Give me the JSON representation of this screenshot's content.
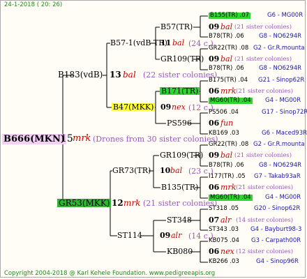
{
  "date": "24-1-2018 ( 20: 26)",
  "root": {
    "id": "B666(MKN)",
    "num": "15",
    "bal": "mrk",
    "note": "(Drones from 30 sister colonies)"
  },
  "gen2": [
    {
      "id": "B183(vdB)",
      "num": "13",
      "bal": "bal",
      "note": "(22 sister colonies)"
    },
    {
      "id": "GR53(MKK)",
      "num": "12",
      "bal": "mrk",
      "note": "(21 sister colonies)"
    }
  ],
  "gen3": [
    {
      "id": "B57-1(vdB-TR)",
      "num": "11",
      "bal": "bal",
      "note": "(24 c.)"
    },
    {
      "id": "B47(MKK)",
      "num": "09",
      "bal": "nex",
      "note": "(12 c.)"
    },
    {
      "id": "GR73(TR)",
      "num": "10",
      "bal": "bal",
      "note": "(23 c.)"
    },
    {
      "id": "ST114",
      "num": "09",
      "bal": "alr",
      "note": "(14 c.)"
    }
  ],
  "gen4": [
    "B57(TR)",
    "GR109(TR)",
    "B171(TR)",
    "PS596",
    "GR109(TR)",
    "B135(TR)",
    "ST348",
    "KB080"
  ],
  "gen5": [
    {
      "top": "B155(TR) .07",
      "top_r": "G6 - MG00R",
      "num": "09",
      "bal": "bal",
      "note": "(21 sister colonies)",
      "bot": "B78(TR) .06",
      "bot_r": "G8 - NO6294R"
    },
    {
      "top": "GR22(TR) .08",
      "top_r": "G2 - Gr.R.mounta",
      "num": "09",
      "bal": "bal",
      "note": "(21 sister colonies)",
      "bot": "B78(TR) .06",
      "bot_r": "G8 - NO6294R"
    },
    {
      "top": "B175(TR) .04",
      "top_r": "G21 - Sinop62R",
      "num": "06",
      "bal": "mrk",
      "note": "(21 sister colonies)",
      "bot": "MG60(TR) .04",
      "bot_r": "G4 - MG00R"
    },
    {
      "top": "PS506 .04",
      "top_r": "G17 - Sinop72R",
      "num": "06",
      "bal": "fun",
      "note": "",
      "bot": "KB169 .03",
      "bot_r": "G6 - Maced93R"
    },
    {
      "top": "GR22(TR) .08",
      "top_r": "G2 - Gr.R.mounta",
      "num": "09",
      "bal": "bal",
      "note": "(21 sister colonies)",
      "bot": "B78(TR) .06",
      "bot_r": "G8 - NO6294R"
    },
    {
      "top": "I177(TR) .05",
      "top_r": "G7 - Takab93aR",
      "num": "06",
      "bal": "mrk",
      "note": "(21 sister colonies)",
      "bot": "MG60(TR) .04",
      "bot_r": "G4 - MG00R"
    },
    {
      "top": "ST318 .05",
      "top_r": "G20 - Sinop62R",
      "num": "07",
      "bal": "alr",
      "note": "(14 sister colonies)",
      "bot": "ST343 .03",
      "bot_r": "G4 - Bayburt98-3"
    },
    {
      "top": "KB075 .04",
      "top_r": "G3 - Carpath00R",
      "num": "06",
      "bal": "nex",
      "note": "(12 sister colonies)",
      "bot": "KB266 .03",
      "bot_r": "G4 - Sinop96R"
    }
  ],
  "footer": "Copyright 2004-2018 @ Karl Kehele Foundation.   www.pedigreeapis.org"
}
